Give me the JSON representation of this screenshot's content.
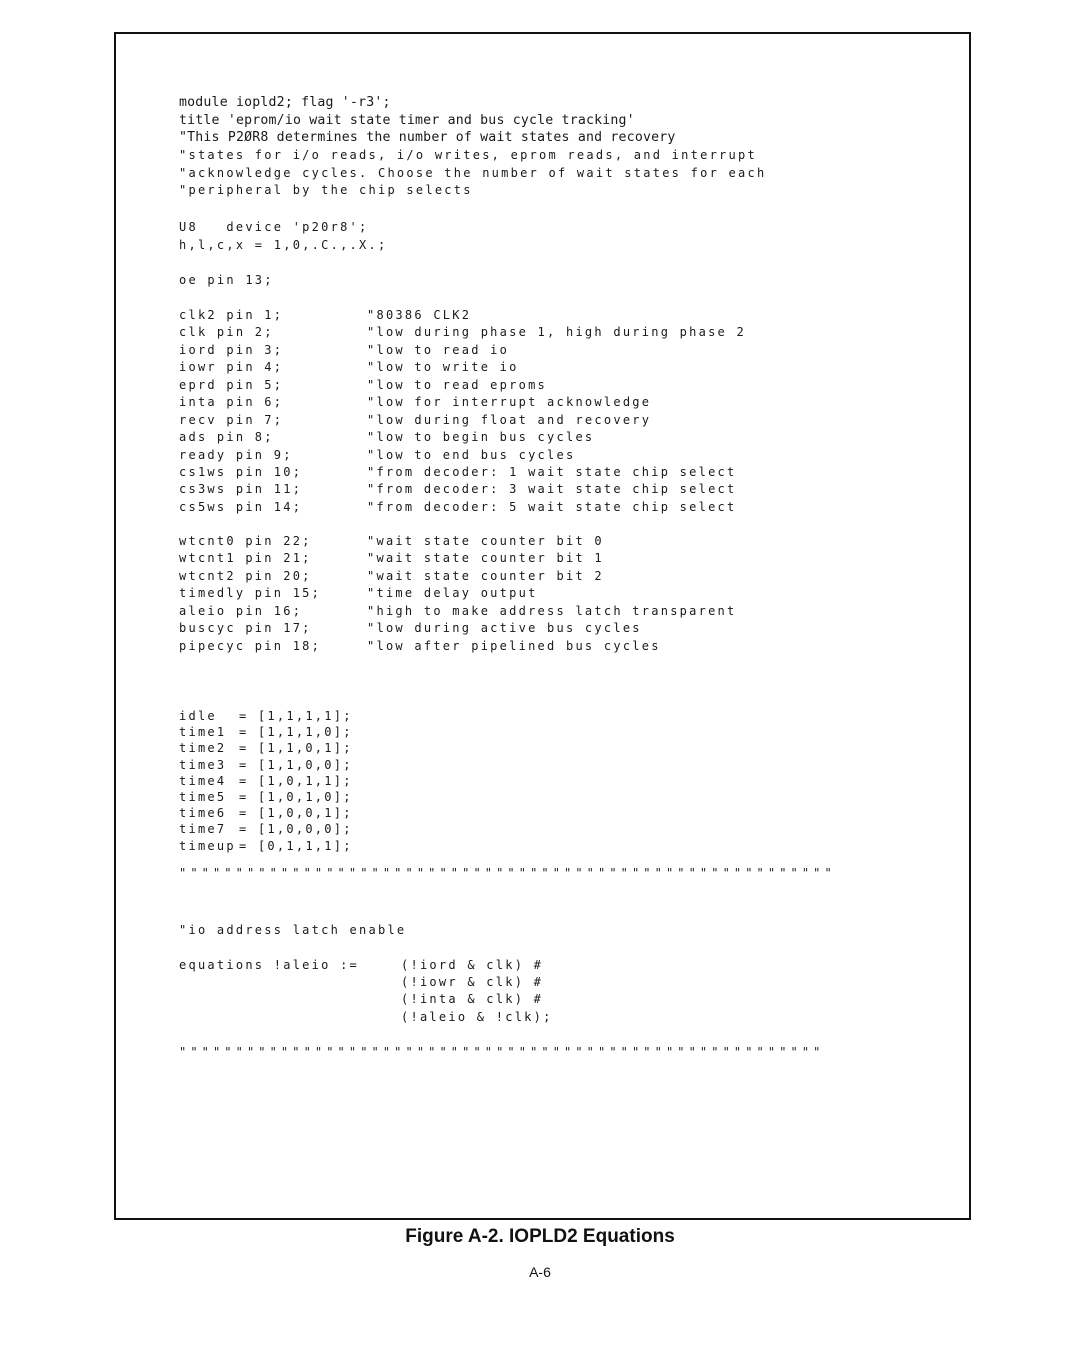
{
  "document": {
    "header_lines": [
      "module iopld2; flag '-r3';",
      "title 'eprom/io wait state timer and bus cycle tracking'",
      "\"This P2ØR8 determines the number of wait states and recovery"
    ],
    "header_comment_lines": [
      "\"states for i/o reads, i/o writes, eprom reads, and interrupt",
      "\"acknowledge cycles. Choose the number of wait states for each",
      "\"peripheral by the chip selects"
    ],
    "device_line": "U8   device 'p20r8';",
    "constants_line": "h,l,c,x = 1,0,.C.,.X.;",
    "oe_line": "oe pin 13;",
    "input_pins": [
      {
        "decl": "clk2 pin 1;",
        "comment": "\"80386 CLK2"
      },
      {
        "decl": "clk pin 2;",
        "comment": "\"low during phase 1, high during phase 2"
      },
      {
        "decl": "iord pin 3;",
        "comment": "\"low to read io"
      },
      {
        "decl": "iowr pin 4;",
        "comment": "\"low to write io"
      },
      {
        "decl": "eprd pin 5;",
        "comment": "\"low to read eproms"
      },
      {
        "decl": "inta pin 6;",
        "comment": "\"low for interrupt acknowledge"
      },
      {
        "decl": "recv pin 7;",
        "comment": "\"low during float and recovery"
      },
      {
        "decl": "ads pin 8;",
        "comment": "\"low to begin bus cycles"
      },
      {
        "decl": "ready pin 9;",
        "comment": "\"low to end bus cycles"
      },
      {
        "decl": "cs1ws pin 10;",
        "comment": "\"from decoder: 1 wait state chip select"
      },
      {
        "decl": "cs3ws pin 11;",
        "comment": "\"from decoder: 3 wait state chip select"
      },
      {
        "decl": "cs5ws pin 14;",
        "comment": "\"from decoder: 5 wait state chip select"
      }
    ],
    "output_pins": [
      {
        "decl": "wtcnt0 pin 22;",
        "comment": "\"wait state counter bit 0"
      },
      {
        "decl": "wtcnt1 pin 21;",
        "comment": "\"wait state counter bit 1"
      },
      {
        "decl": "wtcnt2 pin 20;",
        "comment": "\"wait state counter bit 2"
      },
      {
        "decl": "timedly pin 15;",
        "comment": "\"time delay output"
      },
      {
        "decl": "aleio pin 16;",
        "comment": "\"high to make address latch transparent"
      },
      {
        "decl": "buscyc pin 17;",
        "comment": "\"low during active bus cycles"
      },
      {
        "decl": "pipecyc pin 18;",
        "comment": "\"low after pipelined bus cycles"
      }
    ],
    "state_definitions": [
      {
        "name": "idle",
        "value": "= [1,1,1,1];"
      },
      {
        "name": "time1",
        "value": "= [1,1,1,0];"
      },
      {
        "name": "time2",
        "value": "= [1,1,0,1];"
      },
      {
        "name": "time3",
        "value": "= [1,1,0,0];"
      },
      {
        "name": "time4",
        "value": "= [1,0,1,1];"
      },
      {
        "name": "time5",
        "value": "= [1,0,1,0];"
      },
      {
        "name": "time6",
        "value": "= [1,0,0,1];"
      },
      {
        "name": "time7",
        "value": "= [1,0,0,0];"
      },
      {
        "name": "timeup",
        "value": "= [0,1,1,1];"
      }
    ],
    "separator_1": "\"\"\"\"\"\"\"\"\"\"\"\"\"\"\"\"\"\"\"\"\"\"\"\"\"\"\"\"\"\"\"\"\"\"\"\"\"\"\"\"\"\"\"\"\"\"\"\"\"\"\"\"\"\"\"\"\"\"",
    "section_comment": "\"io address latch enable",
    "equations": [
      {
        "lhs": "equations !aleio :=",
        "rhs": "(!iord & clk) #"
      },
      {
        "lhs": "",
        "rhs": "(!iowr & clk) #"
      },
      {
        "lhs": "",
        "rhs": "(!inta & clk) #"
      },
      {
        "lhs": "",
        "rhs": "(!aleio & !clk);"
      }
    ],
    "separator_2": "\"\"\"\"\"\"\"\"\"\"\"\"\"\"\"\"\"\"\"\"\"\"\"\"\"\"\"\"\"\"\"\"\"\"\"\"\"\"\"\"\"\"\"\"\"\"\"\"\"\"\"\"\"\"\"\"\""
  },
  "caption": "Figure A-2.  IOPLD2 Equations",
  "page_number": "A-6"
}
